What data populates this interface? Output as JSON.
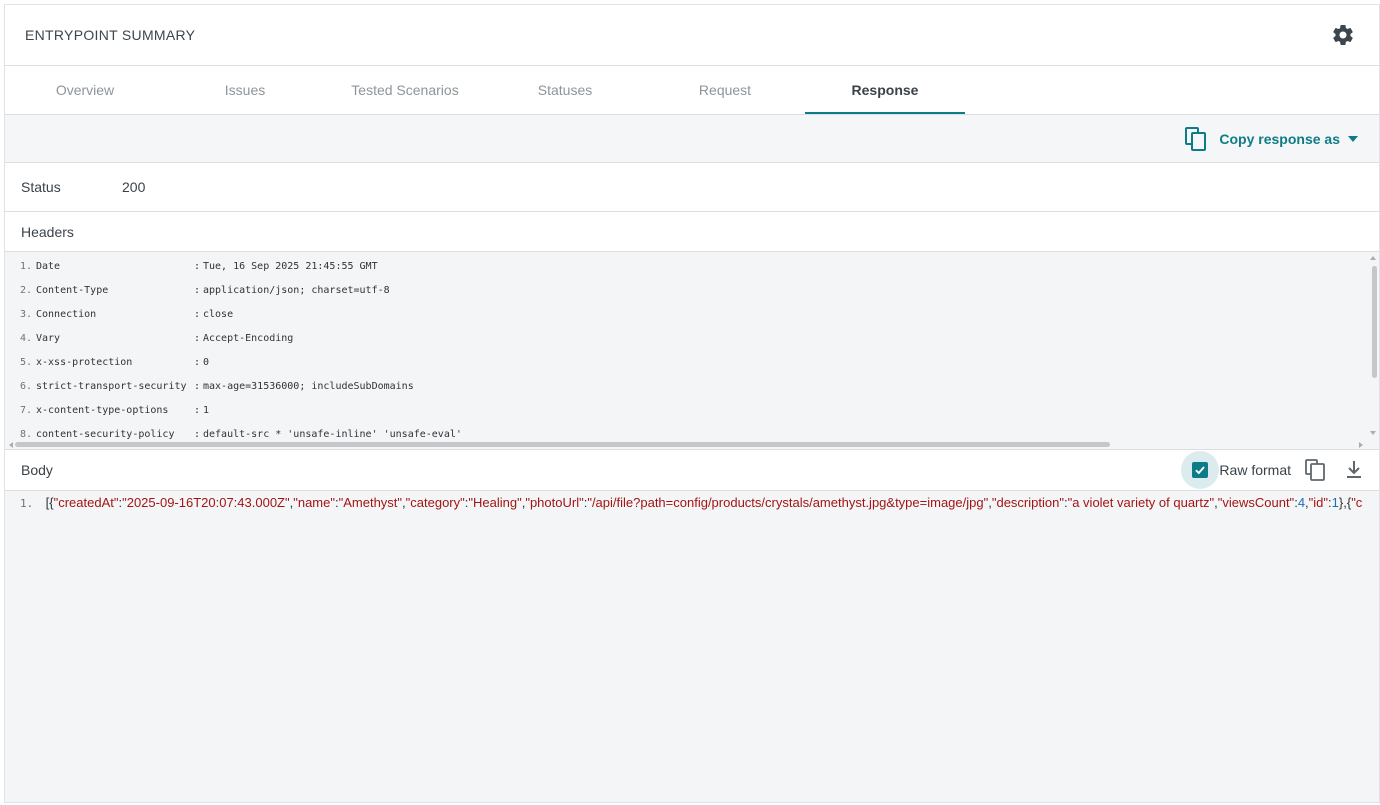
{
  "header": {
    "title": "ENTRYPOINT SUMMARY",
    "settings_icon": "gear-icon"
  },
  "tabs": [
    {
      "label": "Overview",
      "active": false
    },
    {
      "label": "Issues",
      "active": false
    },
    {
      "label": "Tested Scenarios",
      "active": false
    },
    {
      "label": "Statuses",
      "active": false
    },
    {
      "label": "Request",
      "active": false
    },
    {
      "label": "Response",
      "active": true
    }
  ],
  "toolbar": {
    "copy_label": "Copy response as",
    "copy_icon": "copy-icon",
    "dropdown_icon": "caret-down-icon"
  },
  "status": {
    "label": "Status",
    "value": "200"
  },
  "headers_section": {
    "label": "Headers",
    "rows": [
      {
        "num": "1.",
        "key": "Date",
        "value": "Tue, 16 Sep 2025 21:45:55 GMT"
      },
      {
        "num": "2.",
        "key": "Content-Type",
        "value": "application/json; charset=utf-8"
      },
      {
        "num": "3.",
        "key": "Connection",
        "value": "close"
      },
      {
        "num": "4.",
        "key": "Vary",
        "value": "Accept-Encoding"
      },
      {
        "num": "5.",
        "key": "x-xss-protection",
        "value": "0"
      },
      {
        "num": "6.",
        "key": "strict-transport-security",
        "value": "max-age=31536000; includeSubDomains"
      },
      {
        "num": "7.",
        "key": "x-content-type-options",
        "value": "1"
      },
      {
        "num": "8.",
        "key": "content-security-policy",
        "value": "default-src * 'unsafe-inline' 'unsafe-eval'"
      }
    ]
  },
  "body_section": {
    "label": "Body",
    "raw_format_label": "Raw format",
    "raw_format_checked": true,
    "line_num": "1.",
    "segments": [
      {
        "t": "p",
        "v": "[{"
      },
      {
        "t": "s",
        "v": "\"createdAt\""
      },
      {
        "t": "p",
        "v": ":"
      },
      {
        "t": "s",
        "v": "\"2025-09-16T20:07:43.000Z\""
      },
      {
        "t": "p",
        "v": ","
      },
      {
        "t": "s",
        "v": "\"name\""
      },
      {
        "t": "p",
        "v": ":"
      },
      {
        "t": "s",
        "v": "\"Amethyst\""
      },
      {
        "t": "p",
        "v": ","
      },
      {
        "t": "s",
        "v": "\"category\""
      },
      {
        "t": "p",
        "v": ":"
      },
      {
        "t": "s",
        "v": "\"Healing\""
      },
      {
        "t": "p",
        "v": ","
      },
      {
        "t": "s",
        "v": "\"photoUrl\""
      },
      {
        "t": "p",
        "v": ":"
      },
      {
        "t": "s",
        "v": "\"/api/file?path=config/products/crystals/amethyst.jpg&type=image/jpg\""
      },
      {
        "t": "p",
        "v": ","
      },
      {
        "t": "s",
        "v": "\"description\""
      },
      {
        "t": "p",
        "v": ":"
      },
      {
        "t": "s",
        "v": "\"a violet variety of quartz\""
      },
      {
        "t": "p",
        "v": ","
      },
      {
        "t": "s",
        "v": "\"viewsCount\""
      },
      {
        "t": "p",
        "v": ":"
      },
      {
        "t": "n",
        "v": "4"
      },
      {
        "t": "p",
        "v": ","
      },
      {
        "t": "s",
        "v": "\"id\""
      },
      {
        "t": "p",
        "v": ":"
      },
      {
        "t": "n",
        "v": "1"
      },
      {
        "t": "p",
        "v": "},{"
      },
      {
        "t": "s",
        "v": "\"c"
      }
    ],
    "copy_icon": "copy-icon",
    "download_icon": "download-icon"
  },
  "colors": {
    "accent": "#0e7c86",
    "json_string": "#a31515",
    "json_number": "#1a6fb5"
  }
}
